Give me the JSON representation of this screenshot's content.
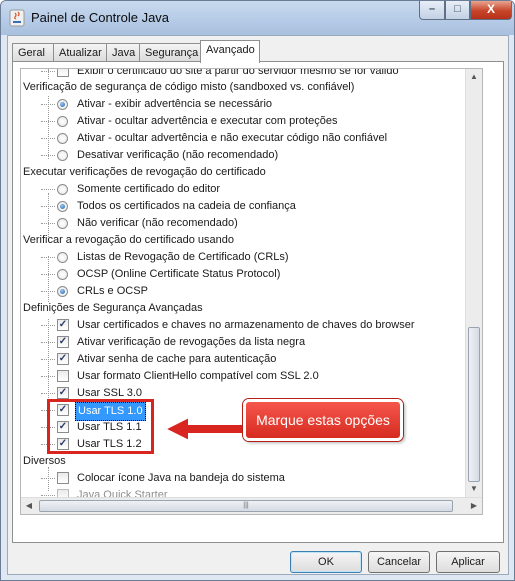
{
  "window": {
    "title": "Painel de Controle Java",
    "controls": {
      "minimize": "–",
      "maximize": "□",
      "close": "X"
    }
  },
  "tabs": [
    "Geral",
    "Atualizar",
    "Java",
    "Segurança",
    "Avançado"
  ],
  "active_tab": "Avançado",
  "tree": {
    "cut_off_top_item": "Exibir o certificado do site a partir do servidor mesmo se for válido",
    "groups": [
      {
        "label": "Verificação de segurança de código misto (sandboxed vs. confiável)",
        "items": [
          {
            "label": "Ativar - exibir advertência se necessário",
            "type": "radio",
            "checked": true
          },
          {
            "label": "Ativar - ocultar advertência e executar com proteções",
            "type": "radio",
            "checked": false
          },
          {
            "label": "Ativar - ocultar advertência e não executar código não confiável",
            "type": "radio",
            "checked": false
          },
          {
            "label": "Desativar verificação (não recomendado)",
            "type": "radio",
            "checked": false
          }
        ]
      },
      {
        "label": "Executar verificações de revogação do certificado",
        "items": [
          {
            "label": "Somente certificado do editor",
            "type": "radio",
            "checked": false
          },
          {
            "label": "Todos os certificados na cadeia de confiança",
            "type": "radio",
            "checked": true
          },
          {
            "label": "Não verificar (não recomendado)",
            "type": "radio",
            "checked": false
          }
        ]
      },
      {
        "label": "Verificar a revogação do certificado usando",
        "items": [
          {
            "label": "Listas de Revogação de Certificado (CRLs)",
            "type": "radio",
            "checked": false
          },
          {
            "label": "OCSP (Online Certificate Status Protocol)",
            "type": "radio",
            "checked": false
          },
          {
            "label": "CRLs e OCSP",
            "type": "radio",
            "checked": true
          }
        ]
      },
      {
        "label": "Definições de Segurança Avançadas",
        "items": [
          {
            "label": "Usar certificados e chaves no armazenamento de chaves do browser",
            "type": "check",
            "checked": true
          },
          {
            "label": "Ativar verificação de revogações da lista negra",
            "type": "check",
            "checked": true
          },
          {
            "label": "Ativar senha de cache para autenticação",
            "type": "check",
            "checked": true
          },
          {
            "label": "Usar formato ClientHello compatível com SSL 2.0",
            "type": "check",
            "checked": false
          },
          {
            "label": "Usar SSL 3.0",
            "type": "check",
            "checked": true
          },
          {
            "label": "Usar TLS 1.0",
            "type": "check",
            "checked": true,
            "selected": true
          },
          {
            "label": "Usar TLS 1.1",
            "type": "check",
            "checked": true
          },
          {
            "label": "Usar TLS 1.2",
            "type": "check",
            "checked": true
          }
        ]
      },
      {
        "label": "Diversos",
        "items": [
          {
            "label": "Colocar ícone Java na bandeja do sistema",
            "type": "check",
            "checked": false
          },
          {
            "label": "Java Quick Starter",
            "type": "check",
            "checked": false,
            "disabled": true
          }
        ]
      }
    ]
  },
  "callout": {
    "text": "Marque estas opções"
  },
  "buttons": {
    "ok": "OK",
    "cancel": "Cancelar",
    "apply": "Aplicar"
  },
  "colors": {
    "highlight": "#d8251f",
    "callout": "#e0392e",
    "selection": "#3399ff"
  }
}
